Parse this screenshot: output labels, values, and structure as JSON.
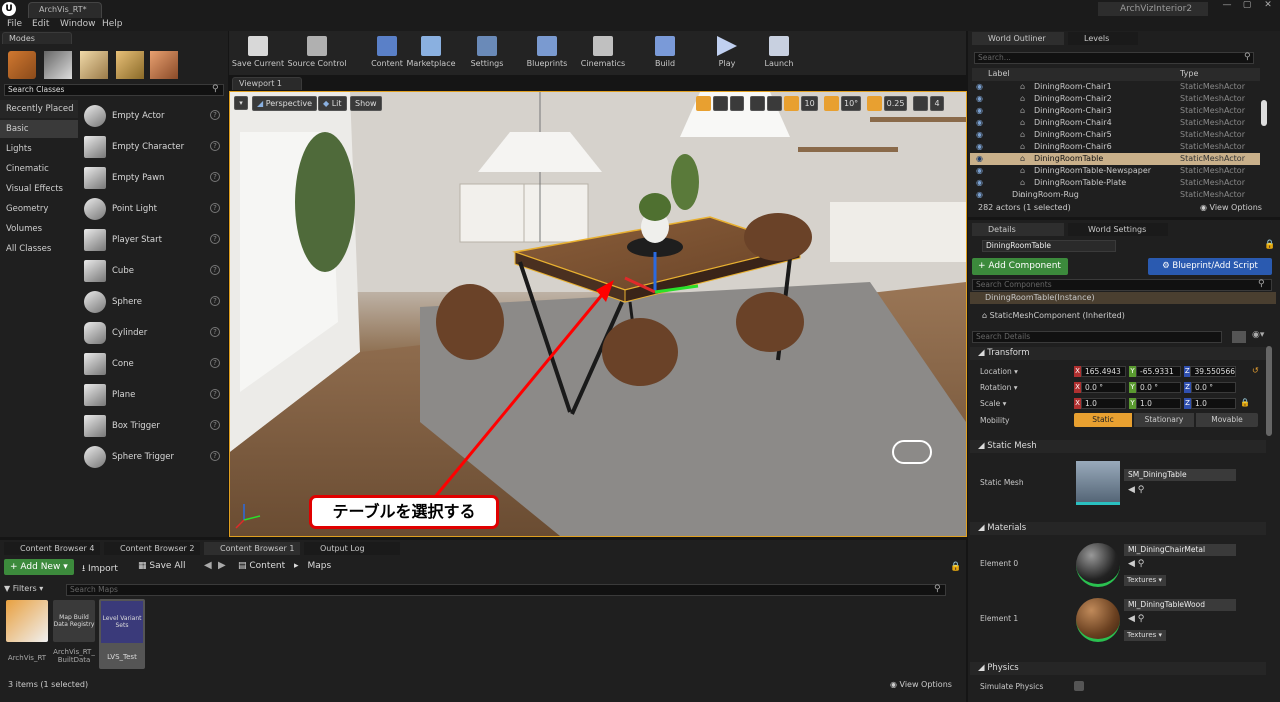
{
  "window": {
    "tab": "ArchVis_RT*",
    "project": "ArchVizInterior2"
  },
  "menu": [
    "File",
    "Edit",
    "Window",
    "Help"
  ],
  "modes": {
    "title": "Modes",
    "search_placeholder": "Search Classes",
    "categories": [
      "Recently Placed",
      "Basic",
      "Lights",
      "Cinematic",
      "Visual Effects",
      "Geometry",
      "Volumes",
      "All Classes"
    ],
    "selected_category": "Basic",
    "items": [
      "Empty Actor",
      "Empty Character",
      "Empty Pawn",
      "Point Light",
      "Player Start",
      "Cube",
      "Sphere",
      "Cylinder",
      "Cone",
      "Plane",
      "Box Trigger",
      "Sphere Trigger"
    ]
  },
  "toolbar": {
    "buttons": [
      "Save Current",
      "Source Control",
      "Content",
      "Marketplace",
      "Settings",
      "Blueprints",
      "Cinematics",
      "Build",
      "Play",
      "Launch"
    ]
  },
  "viewport": {
    "tab": "Viewport 1",
    "perspective": "Perspective",
    "lit": "Lit",
    "show": "Show",
    "grid_snap": "10",
    "rot_snap": "10°",
    "scale_snap": "0.25",
    "cam_speed": "4",
    "annotation": "テーブルを選択する"
  },
  "outliner": {
    "tabs": [
      "World Outliner",
      "Levels"
    ],
    "search_placeholder": "Search...",
    "col_label": "Label",
    "col_type": "Type",
    "rows": [
      {
        "label": "DiningRoom-Chair1",
        "type": "StaticMeshActor"
      },
      {
        "label": "DiningRoom-Chair2",
        "type": "StaticMeshActor"
      },
      {
        "label": "DiningRoom-Chair3",
        "type": "StaticMeshActor"
      },
      {
        "label": "DiningRoom-Chair4",
        "type": "StaticMeshActor"
      },
      {
        "label": "DiningRoom-Chair5",
        "type": "StaticMeshActor"
      },
      {
        "label": "DiningRoom-Chair6",
        "type": "StaticMeshActor"
      },
      {
        "label": "DiningRoomTable",
        "type": "StaticMeshActor"
      },
      {
        "label": "DiningRoomTable-Newspaper",
        "type": "StaticMeshActor"
      },
      {
        "label": "DiningRoomTable-Plate",
        "type": "StaticMeshActor"
      },
      {
        "label": "DiningRoom-Rug",
        "type": "StaticMeshActor"
      }
    ],
    "selected_label": "DiningRoomTable",
    "footer": "282 actors (1 selected)",
    "view_options": "View Options"
  },
  "details": {
    "tabs": [
      "Details",
      "World Settings"
    ],
    "name": "DiningRoomTable",
    "add_component": "+ Add Component",
    "blueprint": "Blueprint/Add Script",
    "search_components": "Search Components",
    "instance": "DiningRoomTable(Instance)",
    "component": "StaticMeshComponent (Inherited)",
    "search_details": "Search Details",
    "transform": "Transform",
    "location_label": "Location",
    "rotation_label": "Rotation",
    "scale_label": "Scale",
    "mobility_label": "Mobility",
    "location": [
      "165.4943",
      "-65.9331",
      "39.550566"
    ],
    "rotation": [
      "0.0 °",
      "0.0 °",
      "0.0 °"
    ],
    "scale": [
      "1.0",
      "1.0",
      "1.0"
    ],
    "mobility": [
      "Static",
      "Stationary",
      "Movable"
    ],
    "static_mesh_section": "Static Mesh",
    "static_mesh_label": "Static Mesh",
    "static_mesh_value": "SM_DiningTable",
    "materials_section": "Materials",
    "element0_label": "Element 0",
    "element0_value": "MI_DiningChairMetal",
    "element1_label": "Element 1",
    "element1_value": "MI_DiningTableWood",
    "textures": "Textures",
    "physics_section": "Physics",
    "simulate_physics": "Simulate Physics"
  },
  "content_browser": {
    "tabs": [
      "Content Browser 4",
      "Content Browser 2",
      "Content Browser 1",
      "Output Log"
    ],
    "add_new": "Add New",
    "import": "Import",
    "save_all": "Save All",
    "path": [
      "Content",
      "Maps"
    ],
    "filters": "Filters",
    "search_placeholder": "Search Maps",
    "assets": [
      {
        "name": "ArchVis_RT",
        "thumb": ""
      },
      {
        "name": "ArchVis_RT_BuiltData",
        "thumb": "Map Build Data Registry"
      },
      {
        "name": "LVS_Test",
        "thumb": "Level Variant Sets"
      }
    ],
    "footer": "3 items (1 selected)",
    "view_options": "View Options"
  }
}
